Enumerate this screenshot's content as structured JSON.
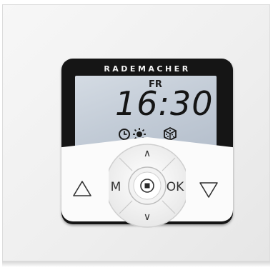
{
  "device": {
    "brand": "RADEMACHER",
    "display": {
      "day": "FR",
      "time": "16:30",
      "icons": [
        "clock-icon",
        "sun-icon",
        "dice-icon"
      ]
    },
    "buttons": {
      "up": "∧",
      "down": "∨",
      "left": "M",
      "right": "OK",
      "stop": "■",
      "open": "△",
      "close": "▽"
    }
  },
  "colors": {
    "lcd": "#c7d0da",
    "housing": "#151515",
    "panel": "#fbfbfb"
  }
}
